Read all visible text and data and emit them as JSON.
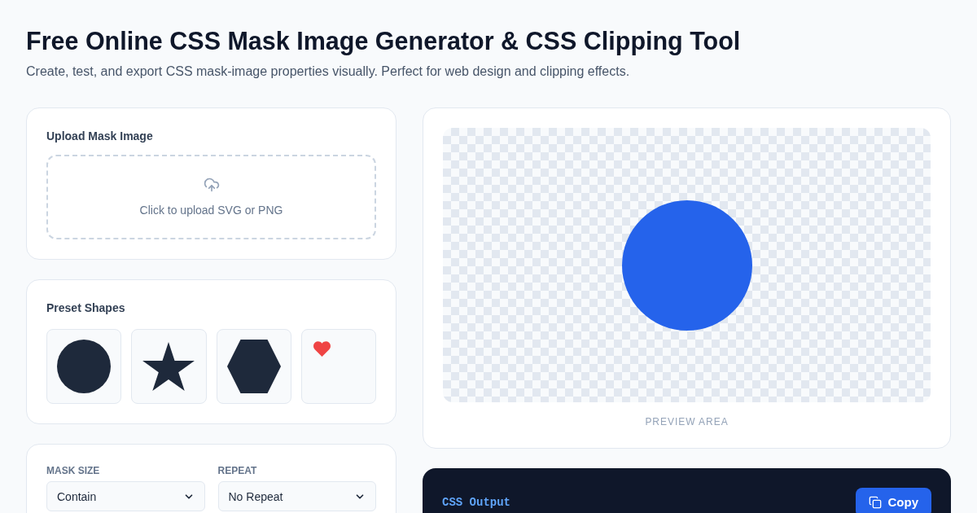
{
  "header": {
    "title": "Free Online CSS Mask Image Generator & CSS Clipping Tool",
    "subtitle": "Create, test, and export CSS mask-image properties visually. Perfect for web design and clipping effects."
  },
  "upload": {
    "title": "Upload Mask Image",
    "hint": "Click to upload SVG or PNG"
  },
  "presets": {
    "title": "Preset Shapes",
    "shapes": [
      {
        "kind": "circle",
        "selected": false
      },
      {
        "kind": "star",
        "selected": false
      },
      {
        "kind": "hexagon",
        "selected": false
      },
      {
        "kind": "heart",
        "selected": false
      }
    ]
  },
  "settings": {
    "fields": [
      {
        "label": "MASK SIZE",
        "value": "Contain"
      },
      {
        "label": "REPEAT",
        "value": "No Repeat"
      }
    ]
  },
  "preview": {
    "kind": "circle",
    "label": "PREVIEW AREA"
  },
  "output": {
    "title": "CSS Output",
    "copy_button": "Copy"
  }
}
